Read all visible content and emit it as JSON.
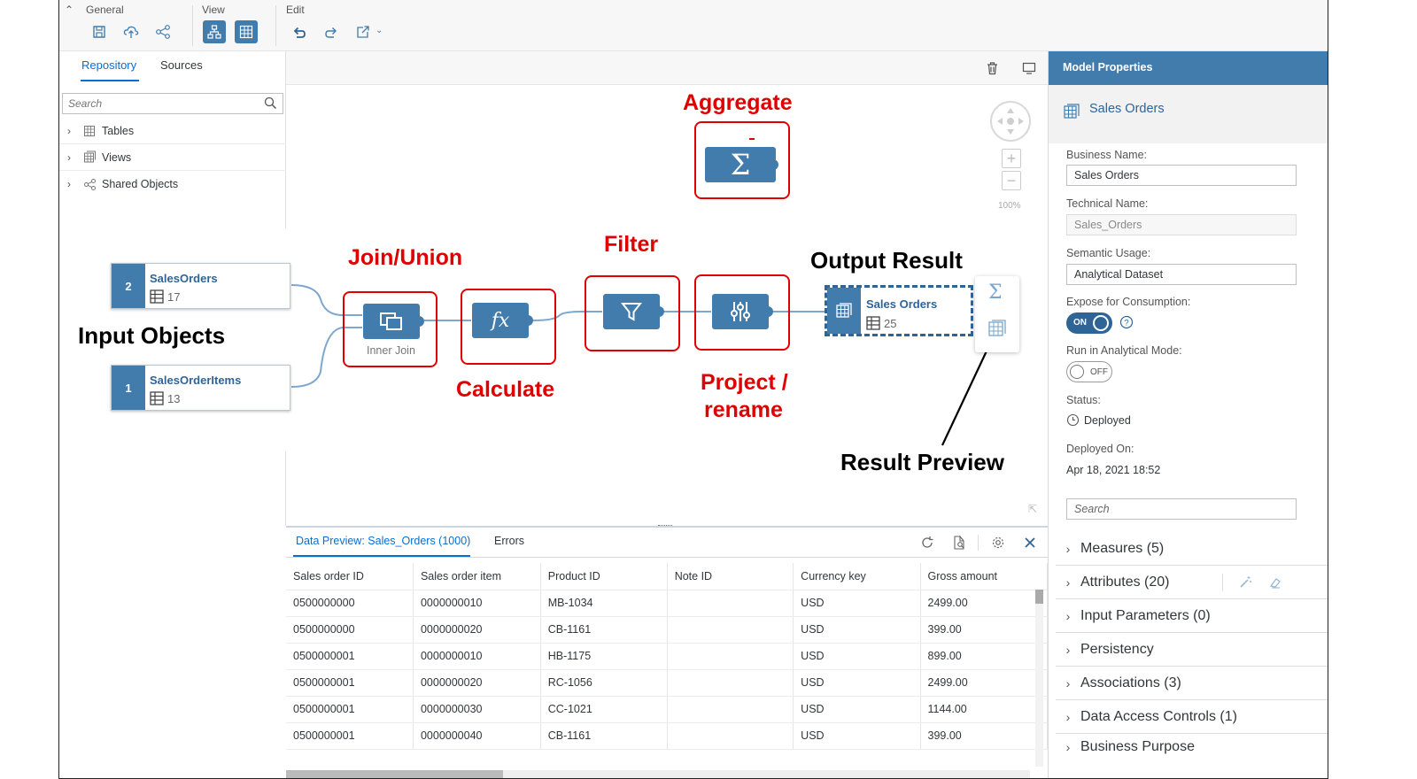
{
  "toolbar": {
    "general_label": "General",
    "view_label": "View",
    "edit_label": "Edit"
  },
  "repository": {
    "tabs": [
      "Repository",
      "Sources"
    ],
    "search_placeholder": "Search",
    "items": [
      "Tables",
      "Views",
      "Shared Objects"
    ]
  },
  "flow": {
    "sources": [
      {
        "number": "2",
        "name": "SalesOrders",
        "count": "17"
      },
      {
        "number": "1",
        "name": "SalesOrderItems",
        "count": "13"
      }
    ],
    "join_label": "Inner Join",
    "output": {
      "name": "Sales Orders",
      "count": "25"
    },
    "zoom": "100%"
  },
  "annotations": {
    "aggregate": "Aggregate",
    "join_union": "Join/Union",
    "filter": "Filter",
    "calculate": "Calculate",
    "project_1": "Project /",
    "project_2": "rename",
    "output_result": "Output Result",
    "input_objects": "Input Objects",
    "result_preview": "Result Preview"
  },
  "preview": {
    "tab_active": "Data Preview: Sales_Orders (1000)",
    "tab_errors": "Errors",
    "columns": [
      "Sales order ID",
      "Sales order item",
      "Product ID",
      "Note ID",
      "Currency key",
      "Gross amount"
    ],
    "rows": [
      [
        "0500000000",
        "0000000010",
        "MB-1034",
        "",
        "USD",
        "2499.00"
      ],
      [
        "0500000000",
        "0000000020",
        "CB-1161",
        "",
        "USD",
        "399.00"
      ],
      [
        "0500000001",
        "0000000010",
        "HB-1175",
        "",
        "USD",
        "899.00"
      ],
      [
        "0500000001",
        "0000000020",
        "RC-1056",
        "",
        "USD",
        "2499.00"
      ],
      [
        "0500000001",
        "0000000030",
        "CC-1021",
        "",
        "USD",
        "1144.00"
      ],
      [
        "0500000001",
        "0000000040",
        "CB-1161",
        "",
        "USD",
        "399.00"
      ]
    ]
  },
  "properties": {
    "header": "Model Properties",
    "object_name": "Sales Orders",
    "business_name_label": "Business Name:",
    "business_name": "Sales Orders",
    "technical_name_label": "Technical Name:",
    "technical_name": "Sales_Orders",
    "semantic_usage_label": "Semantic Usage:",
    "semantic_usage": "Analytical Dataset",
    "expose_label": "Expose for Consumption:",
    "expose_state": "ON",
    "analytical_mode_label": "Run in Analytical Mode:",
    "analytical_mode_state": "OFF",
    "status_label": "Status:",
    "status_value": "Deployed",
    "deployed_on_label": "Deployed On:",
    "deployed_on_value": "Apr 18, 2021 18:52",
    "search_placeholder": "Search",
    "sections": [
      "Measures (5)",
      "Attributes (20)",
      "Input Parameters (0)",
      "Persistency",
      "Associations (3)",
      "Data Access Controls (1)",
      "Business Purpose"
    ]
  },
  "colors": {
    "accent": "#427cac",
    "link": "#0a6ed1",
    "annotation": "#e00000"
  }
}
